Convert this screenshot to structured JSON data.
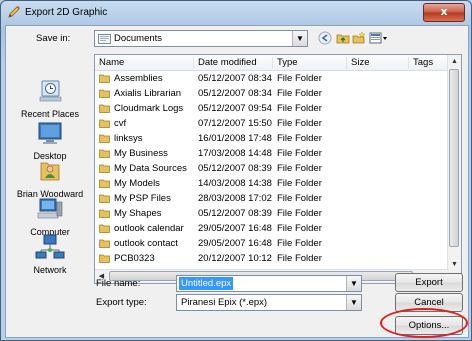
{
  "window": {
    "title": "Export 2D Graphic",
    "close_glyph": "x"
  },
  "toolbar": {
    "save_in_label": "Save in:",
    "location": "Documents",
    "icons": [
      "back-arrow-icon",
      "up-folder-icon",
      "new-folder-icon",
      "views-menu-icon"
    ]
  },
  "places": [
    {
      "label": "Recent Places",
      "icon": "recent-places-icon"
    },
    {
      "label": "Desktop",
      "icon": "desktop-icon"
    },
    {
      "label": "Brian Woodward",
      "icon": "user-folder-icon"
    },
    {
      "label": "Computer",
      "icon": "computer-icon"
    },
    {
      "label": "Network",
      "icon": "network-icon"
    }
  ],
  "columns": [
    "Name",
    "Date modified",
    "Type",
    "Size",
    "Tags"
  ],
  "files": [
    {
      "name": "Assemblies",
      "date": "05/12/2007 08:34",
      "type": "File Folder"
    },
    {
      "name": "Axialis Librarian",
      "date": "05/12/2007 08:34",
      "type": "File Folder"
    },
    {
      "name": "Cloudmark Logs",
      "date": "05/12/2007 09:54",
      "type": "File Folder"
    },
    {
      "name": "cvf",
      "date": "07/12/2007 15:50",
      "type": "File Folder"
    },
    {
      "name": "linksys",
      "date": "16/01/2008 17:48",
      "type": "File Folder"
    },
    {
      "name": "My Business",
      "date": "17/03/2008 14:48",
      "type": "File Folder"
    },
    {
      "name": "My Data Sources",
      "date": "05/12/2007 08:39",
      "type": "File Folder"
    },
    {
      "name": "My Models",
      "date": "14/03/2008 14:38",
      "type": "File Folder"
    },
    {
      "name": "My PSP Files",
      "date": "28/03/2008 17:02",
      "type": "File Folder"
    },
    {
      "name": "My Shapes",
      "date": "05/12/2007 08:39",
      "type": "File Folder"
    },
    {
      "name": "outlook calendar",
      "date": "29/05/2007 16:48",
      "type": "File Folder"
    },
    {
      "name": "outlook contact",
      "date": "29/05/2007 16:48",
      "type": "File Folder"
    },
    {
      "name": "PCB0323",
      "date": "20/12/2007 10:12",
      "type": "File Folder"
    }
  ],
  "form": {
    "file_name_label": "File name:",
    "file_name_value": "Untitled.epx",
    "export_type_label": "Export type:",
    "export_type_value": "Piranesi Epix (*.epx)"
  },
  "buttons": {
    "export": "Export",
    "cancel": "Cancel",
    "options": "Options..."
  },
  "colors": {
    "highlight_ring": "#e02020",
    "selection": "#3399ff",
    "folder": "#e8c15a"
  }
}
